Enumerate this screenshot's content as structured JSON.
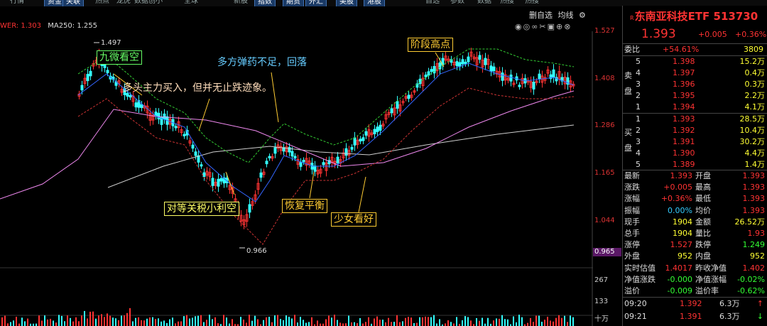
{
  "top_tabs": [
    "行情",
    "资金",
    "关联",
    "热点",
    "龙虎",
    "数据",
    "创小",
    "全球",
    "新股",
    "指数",
    "期货",
    "外汇",
    "美股",
    "港股",
    "自选",
    "参数",
    "数据",
    "热搜",
    "热搜"
  ],
  "legend": {
    "prefix": "WER: 1.303",
    "ma250": "MA250: 1.255"
  },
  "chart_title": [
    "删自选",
    "均线"
  ],
  "chart_icons": [
    "eye-icon",
    "eye-icon",
    "infinity-icon",
    "scissors-icon",
    "box-icon",
    "arrow-icon",
    "close-icon"
  ],
  "y_axis": [
    "1.527",
    "1.408",
    "1.286",
    "1.165",
    "1.044"
  ],
  "current_price_tag": "0.965",
  "high_label": "1.497",
  "low_label": "0.966",
  "vol_axis": [
    "267",
    "133",
    "十万"
  ],
  "annotations": {
    "a1": "九微看空",
    "a2": "多头主力买入，但并无止跌迹象。",
    "a3": "多方弹药不足，回落",
    "a4": "阶段高点",
    "a5": "对等关税小利空",
    "a6": "恢复平衡",
    "a7": "少女看好"
  },
  "panel": {
    "prefix": "R",
    "name": "东南亚科技ETF 513730",
    "price": "1.393",
    "change": "+0.005",
    "change_pct": "+0.36%",
    "weibi_label": "委比",
    "weibi_value": "+54.61%",
    "weibi_vol": "3809",
    "sell_side": "卖盘",
    "buy_side": "买盘",
    "asks": [
      {
        "lvl": "5",
        "price": "1.398",
        "vol": "15.2万"
      },
      {
        "lvl": "4",
        "price": "1.397",
        "vol": "0.4万"
      },
      {
        "lvl": "3",
        "price": "1.396",
        "vol": "0.3万"
      },
      {
        "lvl": "2",
        "price": "1.395",
        "vol": "2.2万"
      },
      {
        "lvl": "1",
        "price": "1.394",
        "vol": "4.1万"
      }
    ],
    "bids": [
      {
        "lvl": "1",
        "price": "1.393",
        "vol": "28.5万"
      },
      {
        "lvl": "2",
        "price": "1.392",
        "vol": "10.4万"
      },
      {
        "lvl": "3",
        "price": "1.391",
        "vol": "30.2万"
      },
      {
        "lvl": "4",
        "price": "1.390",
        "vol": "4.4万"
      },
      {
        "lvl": "5",
        "price": "1.389",
        "vol": "1.4万"
      }
    ],
    "stats": [
      {
        "l1": "最新",
        "v1": "1.393",
        "l2": "开盘",
        "v2": "1.393"
      },
      {
        "l1": "涨跌",
        "v1": "+0.005",
        "l2": "最高",
        "v2": "1.393"
      },
      {
        "l1": "涨幅",
        "v1": "+0.36%",
        "l2": "最低",
        "v2": "1.393"
      },
      {
        "l1": "振幅",
        "v1": "0.00%",
        "l2": "均价",
        "v2": "1.393"
      },
      {
        "l1": "现手",
        "v1": "1904",
        "l2": "金额",
        "v2": "26.52万"
      },
      {
        "l1": "总手",
        "v1": "1904",
        "l2": "量比",
        "v2": "1.93"
      },
      {
        "l1": "涨停",
        "v1": "1.527",
        "l2": "跌停",
        "v2": "1.249"
      },
      {
        "l1": "外盘",
        "v1": "952",
        "l2": "内盘",
        "v2": "952"
      },
      {
        "l1": "实时估值",
        "v1": "1.4017",
        "l2": "昨收净值",
        "v2": "1.402"
      },
      {
        "l1": "净值涨跌",
        "v1": "-0.000",
        "l2": "净值涨幅",
        "v2": "-0.02%"
      },
      {
        "l1": "溢价",
        "v1": "-0.009",
        "l2": "溢价率",
        "v2": "-0.62%"
      }
    ],
    "ticks": [
      {
        "time": "09:20",
        "price": "1.392",
        "vol": "6.3万",
        "dir": "↑"
      },
      {
        "time": "09:21",
        "price": "1.391",
        "vol": "6.3万",
        "dir": "↓"
      }
    ]
  },
  "colors": {
    "up": "#ff3333",
    "down": "#33ff33",
    "accent": "#5a1866",
    "ma_blue": "#3366ff",
    "ma_pink": "#ee88ee"
  }
}
